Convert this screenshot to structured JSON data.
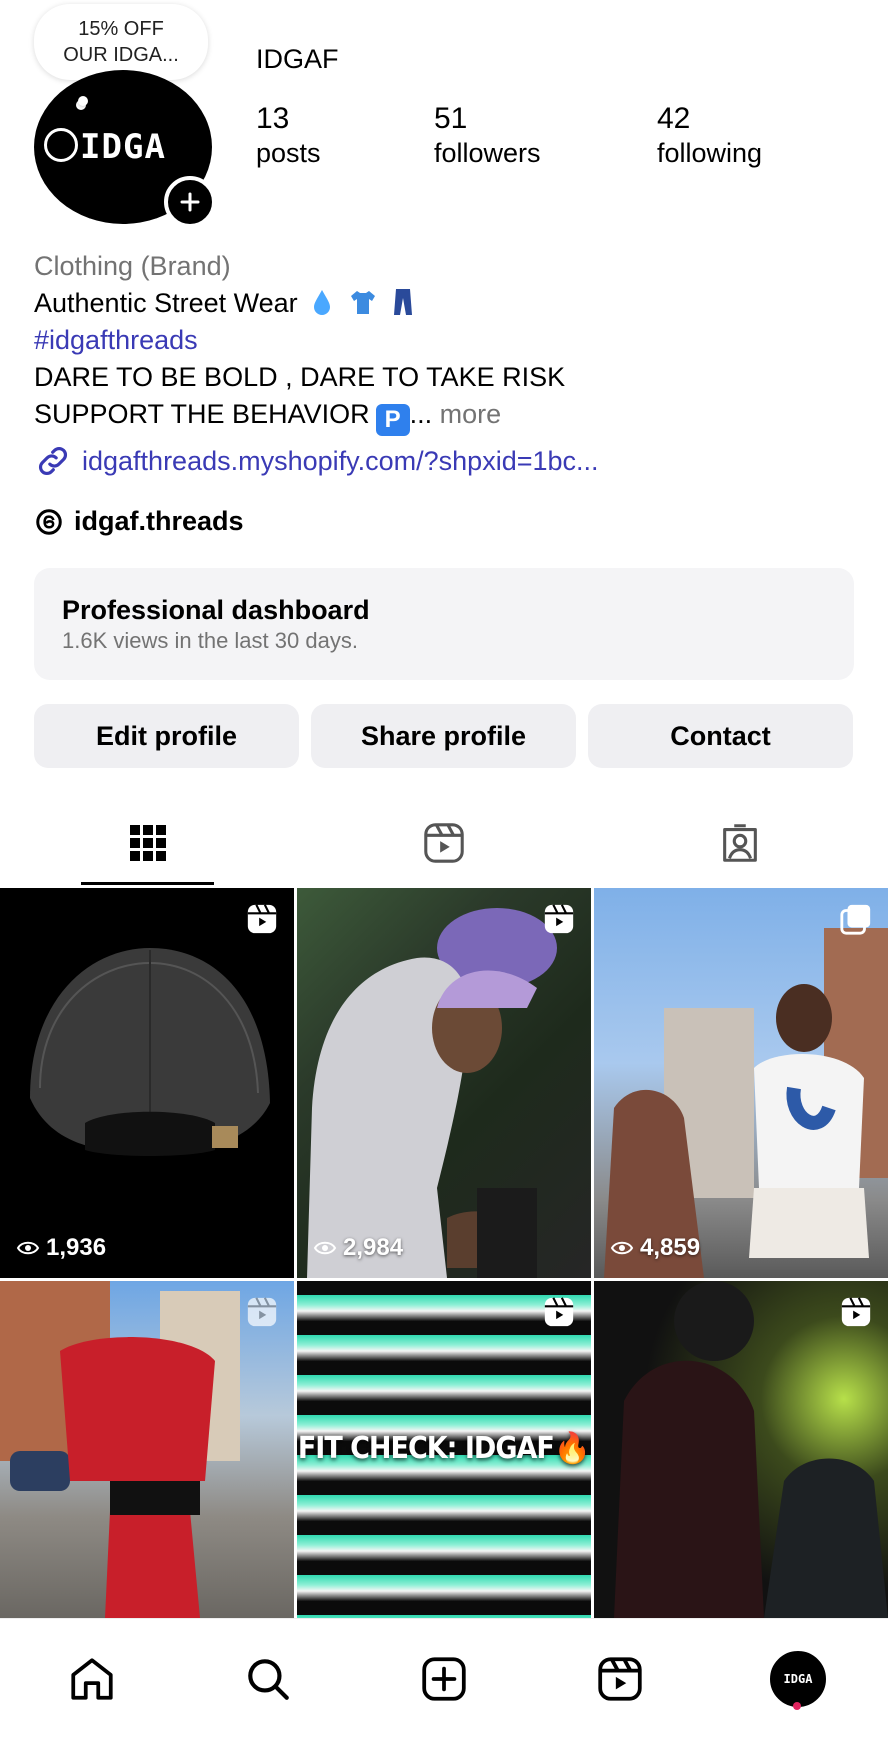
{
  "profile": {
    "note_line1": "15% OFF",
    "note_line2": "OUR IDGA...",
    "avatar_text": "IDGA",
    "username": "IDGAF",
    "stats": [
      {
        "num": "13",
        "label": "posts"
      },
      {
        "num": "51",
        "label": "followers"
      },
      {
        "num": "42",
        "label": "following"
      }
    ]
  },
  "bio": {
    "category": "Clothing (Brand)",
    "line1": "Authentic Street Wear",
    "hashtag": "#idgafthreads",
    "line3": "DARE TO BE BOLD , DARE TO TAKE RISK",
    "line4": "SUPPORT THE BEHAVIOR",
    "badge": "P",
    "ellipsis": "...",
    "more": "more",
    "link": "idgafthreads.myshopify.com/?shpxid=1bc...",
    "threads": "idgaf.threads"
  },
  "dashboard": {
    "title": "Professional dashboard",
    "subtitle": "1.6K views in the last 30 days."
  },
  "buttons": {
    "edit": "Edit profile",
    "share": "Share profile",
    "contact": "Contact"
  },
  "grid": [
    {
      "views": "1,936",
      "type": "reel-icon"
    },
    {
      "views": "2,984",
      "type": "reel-icon"
    },
    {
      "views": "4,859",
      "type": "carousel-icon"
    },
    {
      "views": "",
      "type": "reel-icon"
    },
    {
      "views": "",
      "type": "reel-icon",
      "overlay": "FIT CHECK: IDGAF🔥"
    },
    {
      "views": "",
      "type": "reel-icon"
    }
  ],
  "nav_avatar_text": "IDGA",
  "colors": {
    "link": "#3a3ab5",
    "muted": "#737373",
    "button_bg": "#efeff2",
    "notification_dot": "#e0245e"
  }
}
